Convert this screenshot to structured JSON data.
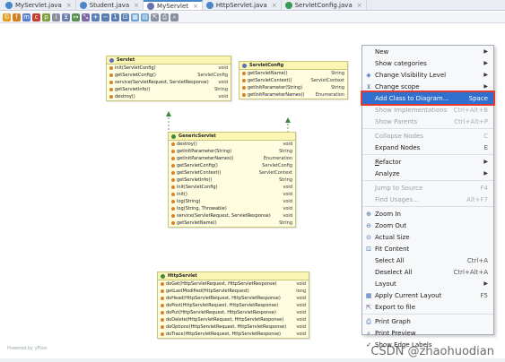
{
  "tabs": [
    {
      "label": "MyServlet.java",
      "active": false
    },
    {
      "label": "Student.java",
      "active": false
    },
    {
      "label": "MyServlet",
      "active": true
    },
    {
      "label": "HttpServlet.java",
      "active": false
    },
    {
      "label": "ServletConfig.java",
      "active": false
    }
  ],
  "tab_close": "×",
  "canvas": {
    "powered_by": "Powered by yFiles",
    "watermark": "CSDN @zhaohuodian"
  },
  "classes": {
    "servlet": {
      "name": "Servlet",
      "methods": [
        {
          "name": "init(ServletConfig)",
          "type": "void"
        },
        {
          "name": "getServletConfig()",
          "type": "ServletConfig"
        },
        {
          "name": "service(ServletRequest, ServletResponse)",
          "type": "void"
        },
        {
          "name": "getServletInfo()",
          "type": "String"
        },
        {
          "name": "destroy()",
          "type": "void"
        }
      ]
    },
    "servletconfig": {
      "name": "ServletConfig",
      "methods": [
        {
          "name": "getServletName()",
          "type": "String"
        },
        {
          "name": "getServletContext()",
          "type": "ServletContext"
        },
        {
          "name": "getInitParameter(String)",
          "type": "String"
        },
        {
          "name": "getInitParameterNames()",
          "type": "Enumeration"
        }
      ]
    },
    "genericservlet": {
      "name": "GenericServlet",
      "methods": [
        {
          "name": "destroy()",
          "type": "void"
        },
        {
          "name": "getInitParameter(String)",
          "type": "String"
        },
        {
          "name": "getInitParameterNames()",
          "type": "Enumeration"
        },
        {
          "name": "getServletConfig()",
          "type": "ServletConfig"
        },
        {
          "name": "getServletContext()",
          "type": "ServletContext"
        },
        {
          "name": "getServletInfo()",
          "type": "String"
        },
        {
          "name": "init(ServletConfig)",
          "type": "void"
        },
        {
          "name": "init()",
          "type": "void"
        },
        {
          "name": "log(String)",
          "type": "void"
        },
        {
          "name": "log(String, Throwable)",
          "type": "void"
        },
        {
          "name": "service(ServletRequest, ServletResponse)",
          "type": "void"
        },
        {
          "name": "getServletName()",
          "type": "String"
        }
      ]
    },
    "httpservlet": {
      "name": "HttpServlet",
      "methods": [
        {
          "name": "doGet(HttpServletRequest, HttpServletResponse)",
          "type": "void"
        },
        {
          "name": "getLastModified(HttpServletRequest)",
          "type": "long"
        },
        {
          "name": "doHead(HttpServletRequest, HttpServletResponse)",
          "type": "void"
        },
        {
          "name": "doPost(HttpServletRequest, HttpServletResponse)",
          "type": "void"
        },
        {
          "name": "doPut(HttpServletRequest, HttpServletResponse)",
          "type": "void"
        },
        {
          "name": "doDelete(HttpServletRequest, HttpServletResponse)",
          "type": "void"
        },
        {
          "name": "doOptions(HttpServletRequest, HttpServletResponse)",
          "type": "void"
        },
        {
          "name": "doTrace(HttpServletRequest, HttpServletResponse)",
          "type": "void"
        }
      ]
    }
  },
  "context_menu": {
    "items": [
      {
        "label": "New",
        "shortcut": "",
        "submenu": true,
        "disabled": false,
        "icon": ""
      },
      {
        "label": "Show categories",
        "shortcut": "",
        "submenu": true,
        "disabled": false,
        "icon": ""
      },
      {
        "label": "Change Visibility Level",
        "shortcut": "",
        "submenu": true,
        "disabled": false,
        "icon": "visibility-icon"
      },
      {
        "label": "Change scope",
        "shortcut": "",
        "submenu": true,
        "disabled": false,
        "icon": "filter-icon"
      },
      {
        "label": "Add Class to Diagram...",
        "shortcut": "Space",
        "submenu": false,
        "disabled": false,
        "icon": "",
        "selected": true
      },
      {
        "label": "Show Implementations",
        "shortcut": "Ctrl+Alt+B",
        "submenu": false,
        "disabled": true,
        "icon": ""
      },
      {
        "label": "Show Parents",
        "shortcut": "Ctrl+Alt+P",
        "submenu": false,
        "disabled": true,
        "icon": ""
      },
      {
        "sep": true
      },
      {
        "label": "Collapse Nodes",
        "shortcut": "C",
        "submenu": false,
        "disabled": true,
        "icon": ""
      },
      {
        "label": "Expand Nodes",
        "shortcut": "E",
        "submenu": false,
        "disabled": false,
        "icon": ""
      },
      {
        "sep": true
      },
      {
        "label": "Refactor",
        "shortcut": "",
        "submenu": true,
        "disabled": false,
        "icon": "",
        "mnemonic": "R"
      },
      {
        "label": "Analyze",
        "shortcut": "",
        "submenu": true,
        "disabled": false,
        "icon": ""
      },
      {
        "sep": true
      },
      {
        "label": "Jump to Source",
        "shortcut": "F4",
        "submenu": false,
        "disabled": true,
        "icon": ""
      },
      {
        "label": "Find Usages...",
        "shortcut": "Alt+F7",
        "submenu": false,
        "disabled": true,
        "icon": ""
      },
      {
        "sep": true
      },
      {
        "label": "Zoom In",
        "shortcut": "",
        "submenu": false,
        "disabled": false,
        "icon": "zoom-in-icon"
      },
      {
        "label": "Zoom Out",
        "shortcut": "",
        "submenu": false,
        "disabled": false,
        "icon": "zoom-out-icon"
      },
      {
        "label": "Actual Size",
        "shortcut": "",
        "submenu": false,
        "disabled": false,
        "icon": "actual-size-icon"
      },
      {
        "label": "Fit Content",
        "shortcut": "",
        "submenu": false,
        "disabled": false,
        "icon": "fit-content-icon"
      },
      {
        "label": "Select All",
        "shortcut": "Ctrl+A",
        "submenu": false,
        "disabled": false,
        "icon": ""
      },
      {
        "label": "Deselect All",
        "shortcut": "Ctrl+Alt+A",
        "submenu": false,
        "disabled": false,
        "icon": ""
      },
      {
        "label": "Layout",
        "shortcut": "",
        "submenu": true,
        "disabled": false,
        "icon": ""
      },
      {
        "label": "Apply Current Layout",
        "shortcut": "F5",
        "submenu": false,
        "disabled": false,
        "icon": "layout-icon"
      },
      {
        "label": "Export to file",
        "shortcut": "",
        "submenu": false,
        "disabled": false,
        "icon": "export-icon"
      },
      {
        "sep": true
      },
      {
        "label": "Print Graph",
        "shortcut": "",
        "submenu": false,
        "disabled": false,
        "icon": "print-icon"
      },
      {
        "label": "Print Preview",
        "shortcut": "",
        "submenu": false,
        "disabled": false,
        "icon": "print-preview-icon"
      },
      {
        "label": "Show Edge Labels",
        "shortcut": "",
        "submenu": false,
        "disabled": false,
        "icon": "",
        "checked": true
      }
    ]
  },
  "colors": {
    "class_fill": "#fffde0",
    "class_header": "#fbf6b4",
    "menu_selection": "#2f6fcf",
    "highlight_box": "#e23a2e",
    "inherit_arrow": "#3b8a3b",
    "extend_arrow": "#2a4aa0"
  }
}
